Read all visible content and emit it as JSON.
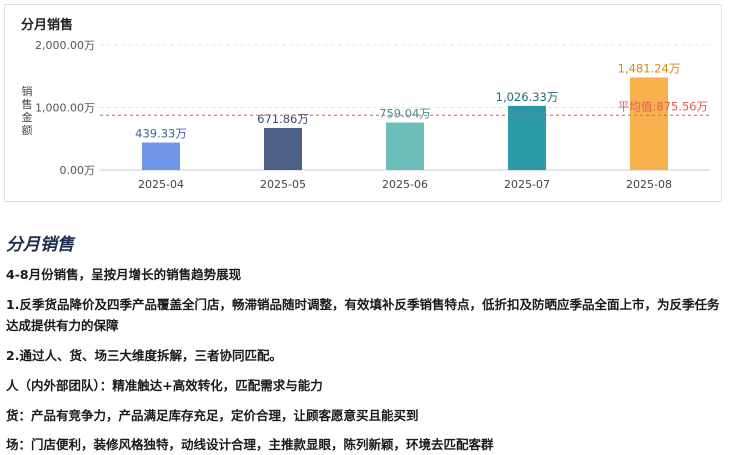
{
  "card": {
    "title": "分月销售"
  },
  "chart_data": {
    "type": "bar",
    "categories": [
      "2025-04",
      "2025-05",
      "2025-06",
      "2025-07",
      "2025-08"
    ],
    "values": [
      439.33,
      671.86,
      759.04,
      1026.33,
      1481.24
    ],
    "value_labels": [
      "439.33万",
      "671.86万",
      "759.04万",
      "1,026.33万",
      "1,481.24万"
    ],
    "colors": [
      "#6f96e8",
      "#4e5f86",
      "#6bbfb8",
      "#2a9aa6",
      "#f7b24e"
    ],
    "label_colors": [
      "#3f5fb0",
      "#3d4a6b",
      "#3f8f8a",
      "#1f6e78",
      "#d98a10"
    ],
    "ylabel": "销售金额",
    "yticks": [
      "0.00万",
      "1,000.00万",
      "2,000.00万"
    ],
    "ytick_values": [
      0,
      1000,
      2000
    ],
    "ylim": [
      0,
      2000
    ],
    "grid": true,
    "average": {
      "value": 875.56,
      "label": "平均值:875.56万",
      "color": "#e35b5b"
    }
  },
  "section": {
    "title": "分月销售",
    "paragraphs": [
      "4-8月份销售，呈按月增长的销售趋势展现",
      "1.反季货品降价及四季产品覆盖全门店，畅滞销品随时调整，有效填补反季销售特点，低折扣及防晒应季品全面上市，为反季任务达成提供有力的保障",
      "2.通过人、货、场三大维度拆解，三者协同匹配。",
      "人（内外部团队）：精准触达+高效转化，匹配需求与能力",
      "货：产品有竞争力，产品满足库存充足，定价合理，让顾客愿意买且能买到",
      "场：门店便利，装修风格独特，动线设计合理，主推款显眼，陈列新颖，环境去匹配客群"
    ]
  }
}
